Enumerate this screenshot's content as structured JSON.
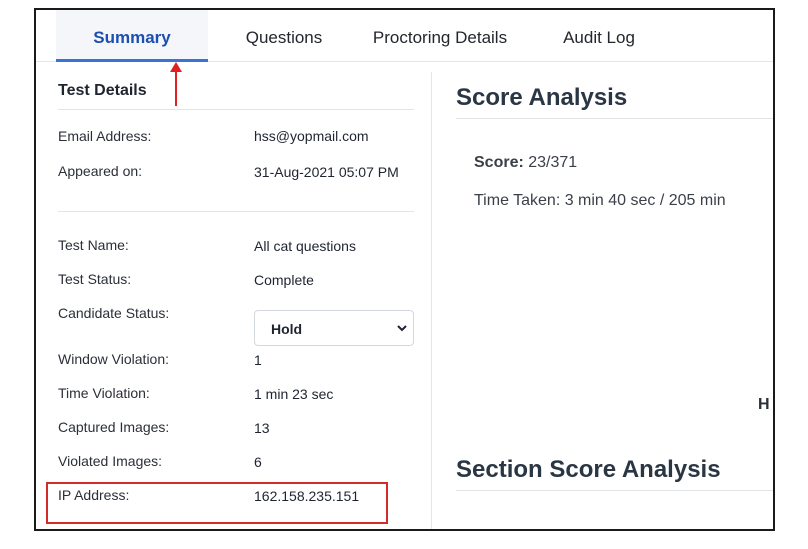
{
  "tabs": [
    {
      "label": "Summary",
      "active": true
    },
    {
      "label": "Questions",
      "active": false
    },
    {
      "label": "Proctoring Details",
      "active": false
    },
    {
      "label": "Audit Log",
      "active": false
    }
  ],
  "test_details": {
    "title": "Test Details",
    "email_label": "Email Address:",
    "email_value": "hss@yopmail.com",
    "appeared_label": "Appeared on:",
    "appeared_value": "31-Aug-2021 05:07 PM",
    "test_name_label": "Test Name:",
    "test_name_value": "All cat questions",
    "test_status_label": "Test Status:",
    "test_status_value": "Complete",
    "candidate_status_label": "Candidate Status:",
    "candidate_status_value": "Hold",
    "window_violation_label": "Window Violation:",
    "window_violation_value": "1",
    "time_violation_label": "Time Violation:",
    "time_violation_value": "1 min 23 sec",
    "captured_images_label": "Captured Images:",
    "captured_images_value": "13",
    "violated_images_label": "Violated Images:",
    "violated_images_value": "6",
    "ip_label": "IP Address:",
    "ip_value": "162.158.235.151"
  },
  "score_analysis": {
    "title": "Score Analysis",
    "score_label": "Score:",
    "score_value": " 23/371",
    "time_taken": "Time Taken: 3 min 40 sec / 205 min",
    "clipped_text": "H"
  },
  "section_score": {
    "title": "Section Score Analysis"
  },
  "colors": {
    "accent": "#1c4fb0",
    "highlight": "#d42a2a"
  }
}
